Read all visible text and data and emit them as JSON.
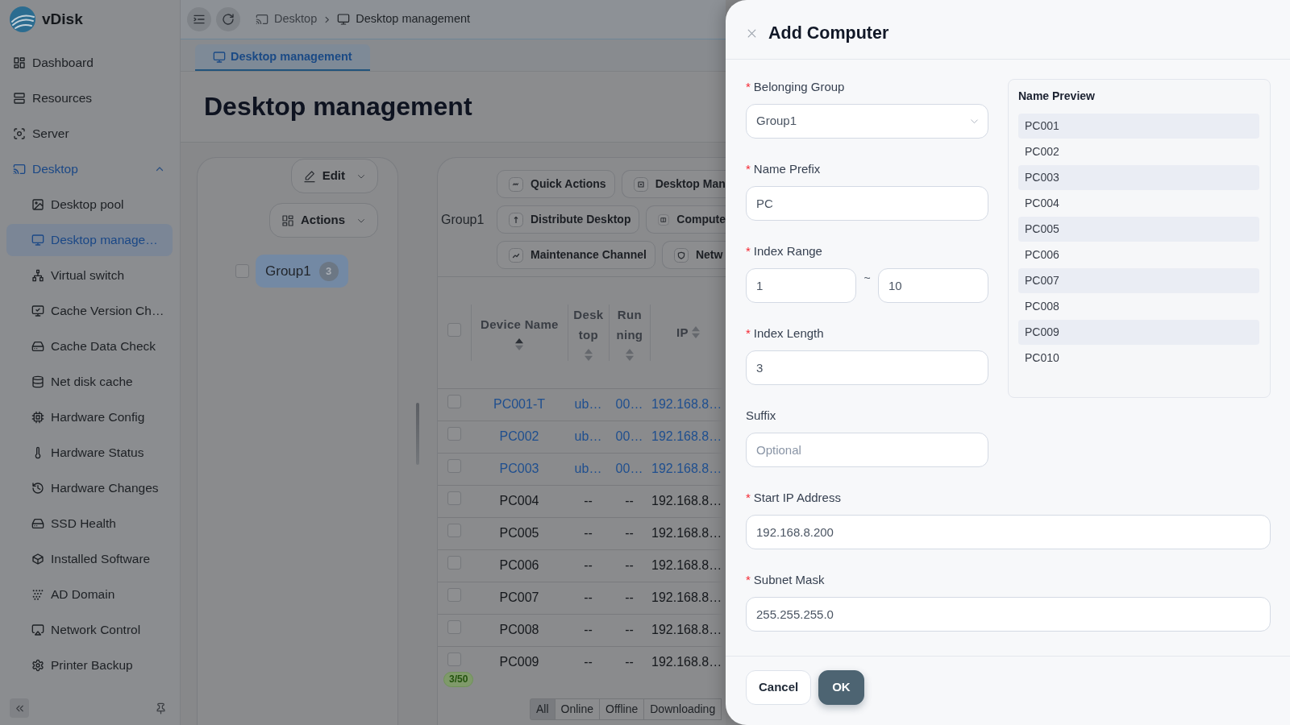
{
  "sidebar": {
    "logo": {
      "text": "vDisk"
    },
    "items": [
      {
        "label": "Dashboard",
        "selected": false
      },
      {
        "label": "Resources",
        "selected": false
      },
      {
        "label": "Server",
        "selected": false
      },
      {
        "label": "Desktop",
        "selected": true,
        "expanded": true,
        "children": [
          {
            "label": "Desktop pool",
            "selected": false
          },
          {
            "label": "Desktop manage…",
            "selected": true
          },
          {
            "label": "Virtual switch",
            "selected": false
          },
          {
            "label": "Cache Version Ch…",
            "selected": false
          },
          {
            "label": "Cache Data Check",
            "selected": false
          },
          {
            "label": "Net disk cache",
            "selected": false
          },
          {
            "label": "Hardware Config",
            "selected": false
          },
          {
            "label": "Hardware Status",
            "selected": false
          },
          {
            "label": "Hardware Changes",
            "selected": false
          },
          {
            "label": "SSD Health",
            "selected": false
          },
          {
            "label": "Installed Software",
            "selected": false
          },
          {
            "label": "AD Domain",
            "selected": false
          },
          {
            "label": "Network Control",
            "selected": false
          },
          {
            "label": "Printer Backup",
            "selected": false
          }
        ]
      }
    ]
  },
  "breadcrumb": [
    {
      "label": "Desktop"
    },
    {
      "label": "Desktop management"
    }
  ],
  "tabs": [
    {
      "label": "Desktop management",
      "selected": true
    }
  ],
  "page_title": "Desktop management",
  "group_panel": {
    "buttons": [
      {
        "label": "Edit"
      },
      {
        "label": "Actions"
      }
    ],
    "groups": [
      {
        "label": "Group1",
        "count": "3",
        "checked": false,
        "selected": true
      }
    ]
  },
  "device_panel": {
    "group_label": "Group1",
    "toolbar": [
      {
        "buttons": [
          {
            "label": "Quick Actions"
          },
          {
            "label": "Desktop Man"
          }
        ]
      },
      {
        "buttons": [
          {
            "label": "Distribute Desktop"
          },
          {
            "label": "Compute"
          }
        ]
      },
      {
        "buttons": [
          {
            "label": "Maintenance Channel"
          },
          {
            "label": "Netw"
          }
        ]
      }
    ],
    "table": {
      "all_checked": false,
      "columns": [
        {
          "label": "Device Name",
          "sorted_ascending": true
        },
        {
          "label": "Desktop",
          "sorted_ascending": false
        },
        {
          "label": "Running",
          "sorted_ascending": false
        },
        {
          "label": "IP",
          "sorted_ascending": false
        }
      ],
      "rows": [
        {
          "name": "PC001-T",
          "desktop": "ub…",
          "running": "00…",
          "ip": "192.168.8…",
          "online": true,
          "checked": false
        },
        {
          "name": "PC002",
          "desktop": "ub…",
          "running": "00…",
          "ip": "192.168.8…",
          "online": true,
          "checked": false
        },
        {
          "name": "PC003",
          "desktop": "ub…",
          "running": "00…",
          "ip": "192.168.8…",
          "online": true,
          "checked": false
        },
        {
          "name": "PC004",
          "desktop": "--",
          "running": "--",
          "ip": "192.168.8…",
          "online": false,
          "checked": false
        },
        {
          "name": "PC005",
          "desktop": "--",
          "running": "--",
          "ip": "192.168.8…",
          "online": false,
          "checked": false
        },
        {
          "name": "PC006",
          "desktop": "--",
          "running": "--",
          "ip": "192.168.8…",
          "online": false,
          "checked": false
        },
        {
          "name": "PC007",
          "desktop": "--",
          "running": "--",
          "ip": "192.168.8…",
          "online": false,
          "checked": false
        },
        {
          "name": "PC008",
          "desktop": "--",
          "running": "--",
          "ip": "192.168.8…",
          "online": false,
          "checked": false
        },
        {
          "name": "PC009",
          "desktop": "--",
          "running": "--",
          "ip": "192.168.8…",
          "online": false,
          "checked": false
        }
      ]
    },
    "count_badge": "3/50",
    "filters": [
      {
        "label": "All",
        "selected": true
      },
      {
        "label": "Online",
        "selected": false
      },
      {
        "label": "Offline",
        "selected": false
      },
      {
        "label": "Downloading",
        "selected": false
      }
    ]
  },
  "drawer": {
    "title": "Add Computer",
    "required_mark": "*",
    "upper_fields": [
      {
        "label": "Belonging Group",
        "required": true,
        "kind": "select",
        "value": "Group1"
      },
      {
        "label": "Name Prefix",
        "required": true,
        "kind": "text",
        "value": "PC"
      },
      {
        "label": "Index Range",
        "required": true,
        "kind": "range",
        "value": "1",
        "separator": "~",
        "value_to": "10"
      },
      {
        "label": "Index Length",
        "required": true,
        "kind": "text",
        "value": "3"
      },
      {
        "label": "Suffix",
        "required": false,
        "kind": "text",
        "placeholder": "Optional"
      }
    ],
    "preview": {
      "title": "Name Preview",
      "items": [
        "PC001",
        "PC002",
        "PC003",
        "PC004",
        "PC005",
        "PC006",
        "PC007",
        "PC008",
        "PC009",
        "PC010"
      ]
    },
    "lower_fields": [
      {
        "label": "Start IP Address",
        "required": true,
        "kind": "text",
        "value": "192.168.8.200"
      },
      {
        "label": "Subnet Mask",
        "required": true,
        "kind": "text",
        "value": "255.255.255.0"
      }
    ],
    "buttons": [
      {
        "label": "Cancel",
        "kind": "secondary"
      },
      {
        "label": "OK",
        "kind": "primary"
      }
    ]
  }
}
